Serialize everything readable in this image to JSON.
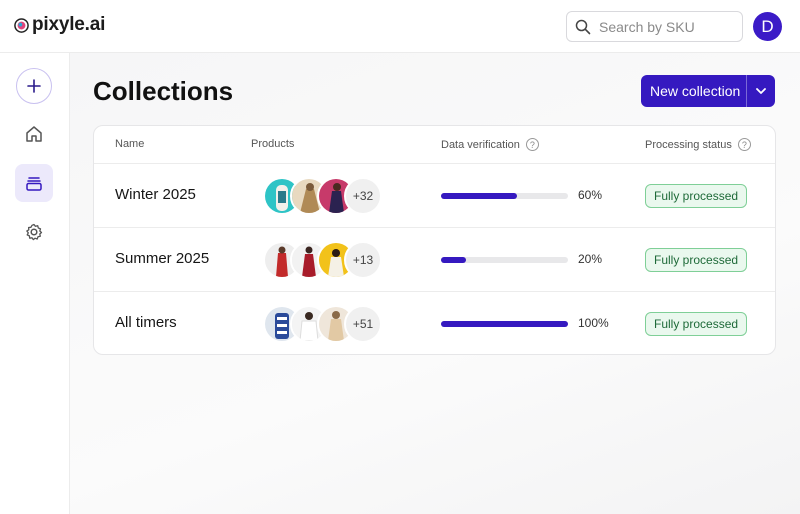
{
  "app": {
    "logo_text": "pixyle.ai"
  },
  "search": {
    "placeholder": "Search by SKU",
    "value": ""
  },
  "user": {
    "avatar_initial": "D"
  },
  "sidebar": {
    "items": [
      {
        "id": "add",
        "icon": "plus-icon"
      },
      {
        "id": "home",
        "icon": "home-icon"
      },
      {
        "id": "collections",
        "icon": "collections-icon",
        "active": true
      },
      {
        "id": "settings",
        "icon": "gear-icon"
      }
    ]
  },
  "page": {
    "title": "Collections",
    "new_button_label": "New collection"
  },
  "table": {
    "headers": {
      "name": "Name",
      "products": "Products",
      "verification": "Data verification",
      "status": "Processing status"
    },
    "rows": [
      {
        "name": "Winter 2025",
        "more": "+32",
        "progress": 0.6,
        "progress_label": "60%",
        "status": "Fully processed"
      },
      {
        "name": "Summer 2025",
        "more": "+13",
        "progress": 0.2,
        "progress_label": "20%",
        "status": "Fully processed"
      },
      {
        "name": "All timers",
        "more": "+51",
        "progress": 1.0,
        "progress_label": "100%",
        "status": "Fully processed"
      }
    ]
  },
  "colors": {
    "accent": "#3519c0",
    "status_bg": "#eaf8ee",
    "status_border": "#7fcf97"
  }
}
